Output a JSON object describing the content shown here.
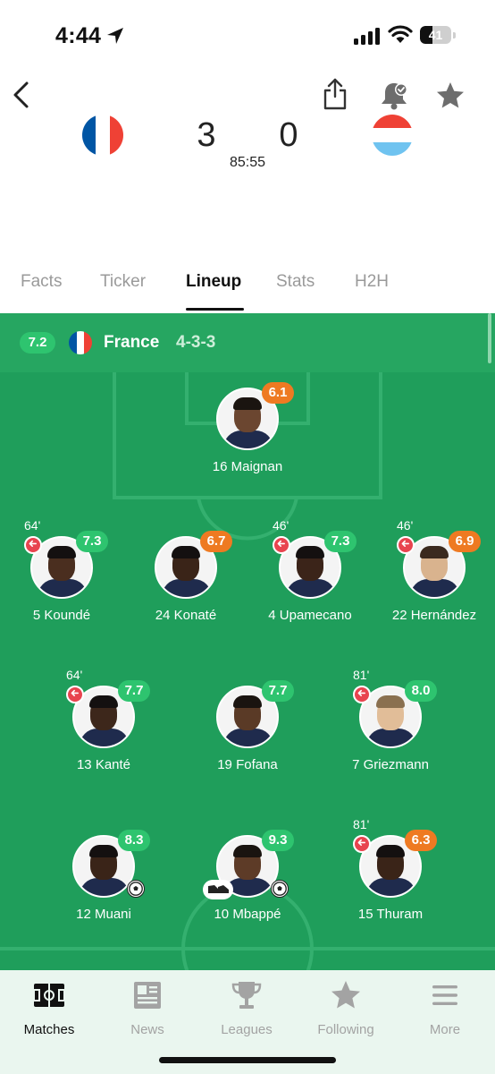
{
  "status_bar": {
    "time": "4:44",
    "battery": "41",
    "battery_level": 0.41
  },
  "header": {
    "home_score": "3",
    "away_score": "0",
    "clock": "85:55",
    "home_flag_colors": [
      "#0055A4",
      "#FFFFFF",
      "#EF4135"
    ],
    "away_flag_colors": [
      "#EF4135",
      "#FFFFFF",
      "#6FC3F0"
    ]
  },
  "tabs": [
    {
      "label": "Facts",
      "active": false
    },
    {
      "label": "Ticker",
      "active": false
    },
    {
      "label": "Lineup",
      "active": true
    },
    {
      "label": "Stats",
      "active": false
    },
    {
      "label": "H2H",
      "active": false
    }
  ],
  "team": {
    "rating": "7.2",
    "name": "France",
    "formation": "4-3-3"
  },
  "players": [
    {
      "name": "16 Maignan",
      "rating": "6.1",
      "rating_color": "orange",
      "sub_minute": "",
      "goal": false,
      "assist": false
    },
    {
      "name": "5 Koundé",
      "rating": "7.3",
      "rating_color": "green",
      "sub_minute": "64'",
      "goal": false,
      "assist": false
    },
    {
      "name": "24 Konaté",
      "rating": "6.7",
      "rating_color": "orange",
      "sub_minute": "",
      "goal": false,
      "assist": false
    },
    {
      "name": "4 Upamecano",
      "rating": "7.3",
      "rating_color": "green",
      "sub_minute": "46'",
      "goal": false,
      "assist": false
    },
    {
      "name": "22 Hernández",
      "rating": "6.9",
      "rating_color": "orange",
      "sub_minute": "46'",
      "goal": false,
      "assist": false
    },
    {
      "name": "13 Kanté",
      "rating": "7.7",
      "rating_color": "green",
      "sub_minute": "64'",
      "goal": false,
      "assist": false
    },
    {
      "name": "19 Fofana",
      "rating": "7.7",
      "rating_color": "green",
      "sub_minute": "",
      "goal": false,
      "assist": false
    },
    {
      "name": "7 Griezmann",
      "rating": "8.0",
      "rating_color": "green",
      "sub_minute": "81'",
      "goal": false,
      "assist": false
    },
    {
      "name": "12 Muani",
      "rating": "8.3",
      "rating_color": "green",
      "sub_minute": "",
      "goal": true,
      "assist": false
    },
    {
      "name": "10 Mbappé",
      "rating": "9.3",
      "rating_color": "green",
      "sub_minute": "",
      "goal": true,
      "assist": true
    },
    {
      "name": "15 Thuram",
      "rating": "6.3",
      "rating_color": "orange",
      "sub_minute": "81'",
      "goal": false,
      "assist": false
    }
  ],
  "nav": [
    {
      "label": "Matches",
      "icon": "pitch-icon",
      "active": true
    },
    {
      "label": "News",
      "icon": "newspaper-icon",
      "active": false
    },
    {
      "label": "Leagues",
      "icon": "trophy-icon",
      "active": false
    },
    {
      "label": "Following",
      "icon": "star-icon",
      "active": false
    },
    {
      "label": "More",
      "icon": "menu-icon",
      "active": false
    }
  ],
  "colors": {
    "pitch": "#1f9e5b",
    "rating_green": "#2ec46f",
    "rating_orange": "#ee7a22",
    "sub_red": "#e8444f"
  }
}
